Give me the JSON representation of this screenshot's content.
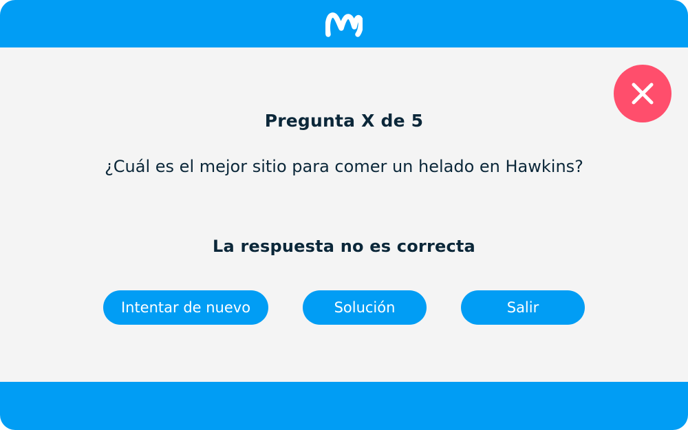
{
  "header": {
    "logo_icon": "movistar-m-logo-icon",
    "background_color": "#019df4"
  },
  "dialog": {
    "close_icon": "close-icon",
    "close_color": "#ff4e6c",
    "title": "Pregunta X de 5",
    "question": "¿Cuál es el mejor sitio para comer un helado en Hawkins?",
    "result": "La respuesta no es correcta"
  },
  "actions": {
    "retry_label": "Intentar de nuevo",
    "solution_label": "Solución",
    "exit_label": "Salir",
    "button_color": "#019df4"
  }
}
